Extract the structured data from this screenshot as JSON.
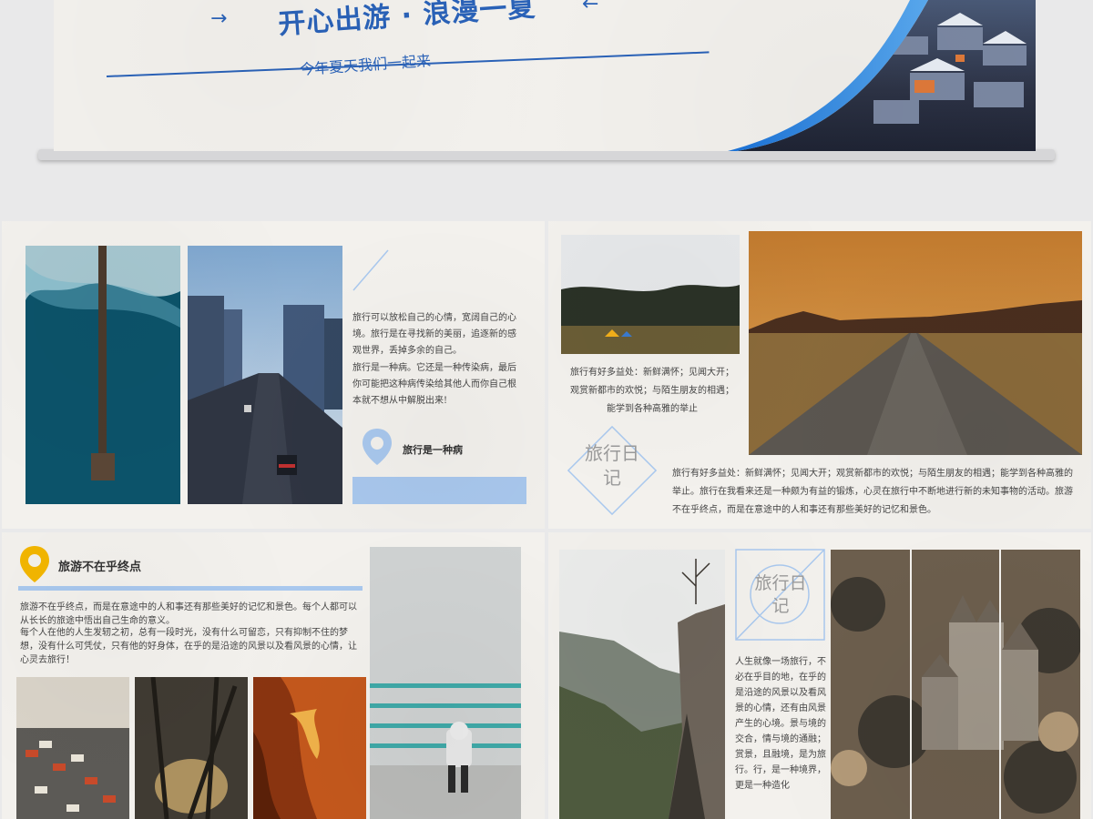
{
  "hero": {
    "title": "开心出游 · 浪漫一夏",
    "subtitle": "今年夏天我们一起来",
    "arrow_left": "→",
    "arrow_right": "←"
  },
  "slide1": {
    "para1": "旅行可以放松自己的心情，宽阔自己的心境。旅行是在寻找新的美丽，追逐新的感观世界，丢掉多余的自己。",
    "para2": "旅行是一种病。它还是一种传染病，最后你可能把这种病传染给其他人而你自己根本就不想从中解脱出来!",
    "tag": "旅行是一种病"
  },
  "slide2": {
    "caption": "旅行有好多益处：新鲜满怀；见闻大开；观赏新都市的欢悦；与陌生朋友的相遇；能学到各种高雅的举止",
    "stamp": "旅行日记",
    "body": "旅行有好多益处：新鲜满怀；见闻大开；观赏新都市的欢悦；与陌生朋友的相遇；能学到各种高雅的举止。旅行在我看来还是一种颇为有益的锻炼，心灵在旅行中不断地进行新的未知事物的活动。旅游不在乎终点，而是在意途中的人和事还有那些美好的记忆和景色。"
  },
  "slide3": {
    "heading": "旅游不在乎终点",
    "para1": "旅游不在乎终点，而是在意途中的人和事还有那些美好的记忆和景色。每个人都可以从长长的旅途中悟出自己生命的意义。",
    "para2": "每个人在他的人生发轫之初，总有一段时光，没有什么可留恋，只有抑制不住的梦想，没有什么可凭仗，只有他的好身体，在乎的是沿途的风景以及看风景的心情，让心灵去旅行！"
  },
  "slide4": {
    "stamp": "旅行日记",
    "body": "人生就像一场旅行，不必在乎目的地，在乎的是沿途的风景以及看风景的心情，还有由风景产生的心境。景与境的交合，情与境的通融；赏景，且融境，是为旅行。行，是一种境界，更是一种造化"
  },
  "colors": {
    "accent_blue": "#2a62b8",
    "light_blue": "#a9c8ee",
    "yellow": "#f3b600",
    "paper": "#f3f1ed"
  }
}
